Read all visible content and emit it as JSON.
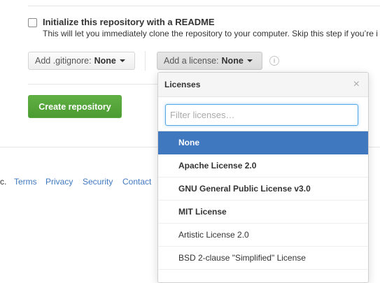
{
  "readme": {
    "label": "Initialize this repository with a README",
    "note": "This will let you immediately clone the repository to your computer. Skip this step if you’re i"
  },
  "gitignore": {
    "prefix": "Add .gitignore:",
    "value": "None"
  },
  "license": {
    "prefix": "Add a license:",
    "value": "None"
  },
  "info_icon": "i",
  "create_button": "Create repository",
  "footer": {
    "fragment": "c.",
    "links": [
      "Terms",
      "Privacy",
      "Security",
      "Contact"
    ]
  },
  "licenses_dropdown": {
    "title": "Licenses",
    "close": "×",
    "filter_placeholder": "Filter licenses…",
    "items": [
      {
        "label": "None"
      },
      {
        "label": "Apache License 2.0"
      },
      {
        "label": "GNU General Public License v3.0"
      },
      {
        "label": "MIT License"
      },
      {
        "label": "Artistic License 2.0"
      },
      {
        "label": "BSD 2-clause \"Simplified\" License"
      }
    ]
  },
  "colors": {
    "create_button": "#55a532",
    "selected_item": "#4078c0",
    "link": "#4078c0"
  }
}
